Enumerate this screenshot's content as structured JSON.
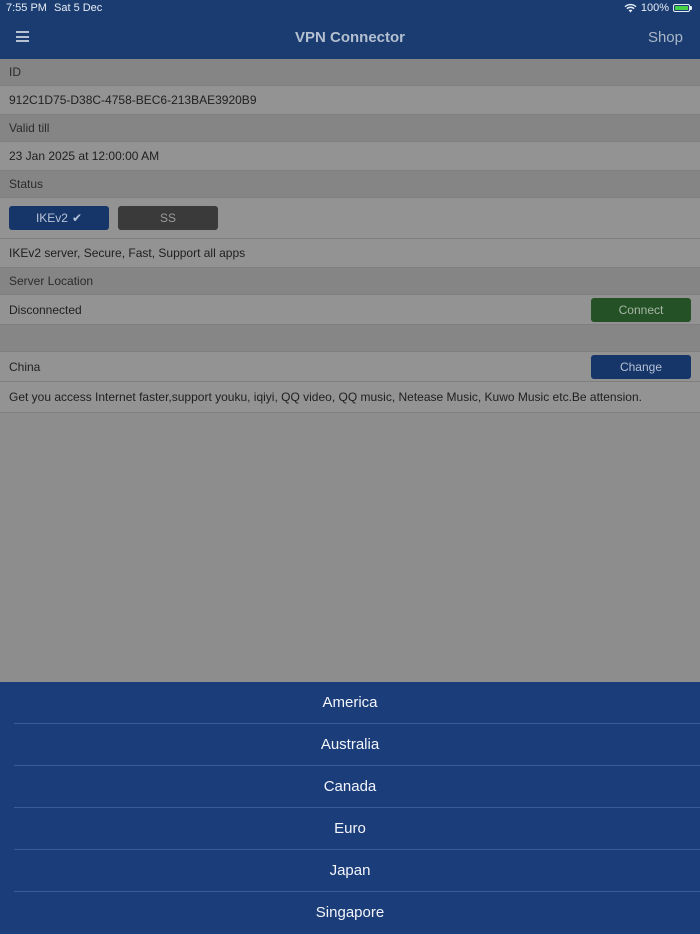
{
  "status_bar": {
    "time": "7:55 PM",
    "date": "Sat 5 Dec",
    "battery": "100%",
    "wifi_icon": "wifi-icon",
    "battery_color": "#47d14a"
  },
  "navbar": {
    "title": "VPN Connector",
    "shop_label": "Shop",
    "menu_icon": "hamburger-menu-icon",
    "background": "#1a3c70"
  },
  "fields": {
    "id_label": "ID",
    "id_value": "912C1D75-D38C-4758-BEC6-213BAE3920B9",
    "valid_label": "Valid till",
    "valid_value": "23 Jan 2025 at 12:00:00 AM",
    "status_label": "Status",
    "protocol_ikev2": "IKEv2",
    "protocol_ss": "SS",
    "protocol_description": "IKEv2 server, Secure, Fast, Support all apps",
    "server_location_label": "Server Location",
    "connection_status": "Disconnected",
    "connect_label": "Connect",
    "country": "China",
    "change_label": "Change",
    "country_description": "Get you access Internet faster,support youku, iqiyi, QQ video, QQ music, Netease Music, Kuwo Music etc.Be attension."
  },
  "location_sheet": {
    "options": [
      "America",
      "Australia",
      "Canada",
      "Euro",
      "Japan",
      "Singapore"
    ],
    "background": "#1b3d7a"
  }
}
